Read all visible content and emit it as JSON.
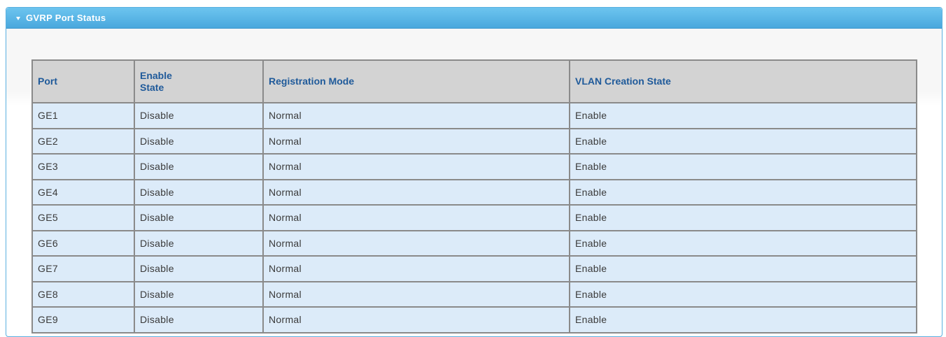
{
  "panel": {
    "title": "GVRP Port Status"
  },
  "table": {
    "headers": {
      "port": "Port",
      "enable_state": "Enable State",
      "registration_mode": "Registration Mode",
      "vlan_creation_state": "VLAN Creation State"
    },
    "rows": [
      {
        "port": "GE1",
        "enable_state": "Disable",
        "registration_mode": "Normal",
        "vlan_creation_state": "Enable"
      },
      {
        "port": "GE2",
        "enable_state": "Disable",
        "registration_mode": "Normal",
        "vlan_creation_state": "Enable"
      },
      {
        "port": "GE3",
        "enable_state": "Disable",
        "registration_mode": "Normal",
        "vlan_creation_state": "Enable"
      },
      {
        "port": "GE4",
        "enable_state": "Disable",
        "registration_mode": "Normal",
        "vlan_creation_state": "Enable"
      },
      {
        "port": "GE5",
        "enable_state": "Disable",
        "registration_mode": "Normal",
        "vlan_creation_state": "Enable"
      },
      {
        "port": "GE6",
        "enable_state": "Disable",
        "registration_mode": "Normal",
        "vlan_creation_state": "Enable"
      },
      {
        "port": "GE7",
        "enable_state": "Disable",
        "registration_mode": "Normal",
        "vlan_creation_state": "Enable"
      },
      {
        "port": "GE8",
        "enable_state": "Disable",
        "registration_mode": "Normal",
        "vlan_creation_state": "Enable"
      },
      {
        "port": "GE9",
        "enable_state": "Disable",
        "registration_mode": "Normal",
        "vlan_creation_state": "Enable"
      }
    ]
  },
  "colors": {
    "header_bar": "#4aa8dd",
    "table_header_bg": "#d3d3d3",
    "table_header_text": "#1f5a9a",
    "row_bg": "#dcebf9",
    "border": "#8a8a8a"
  }
}
